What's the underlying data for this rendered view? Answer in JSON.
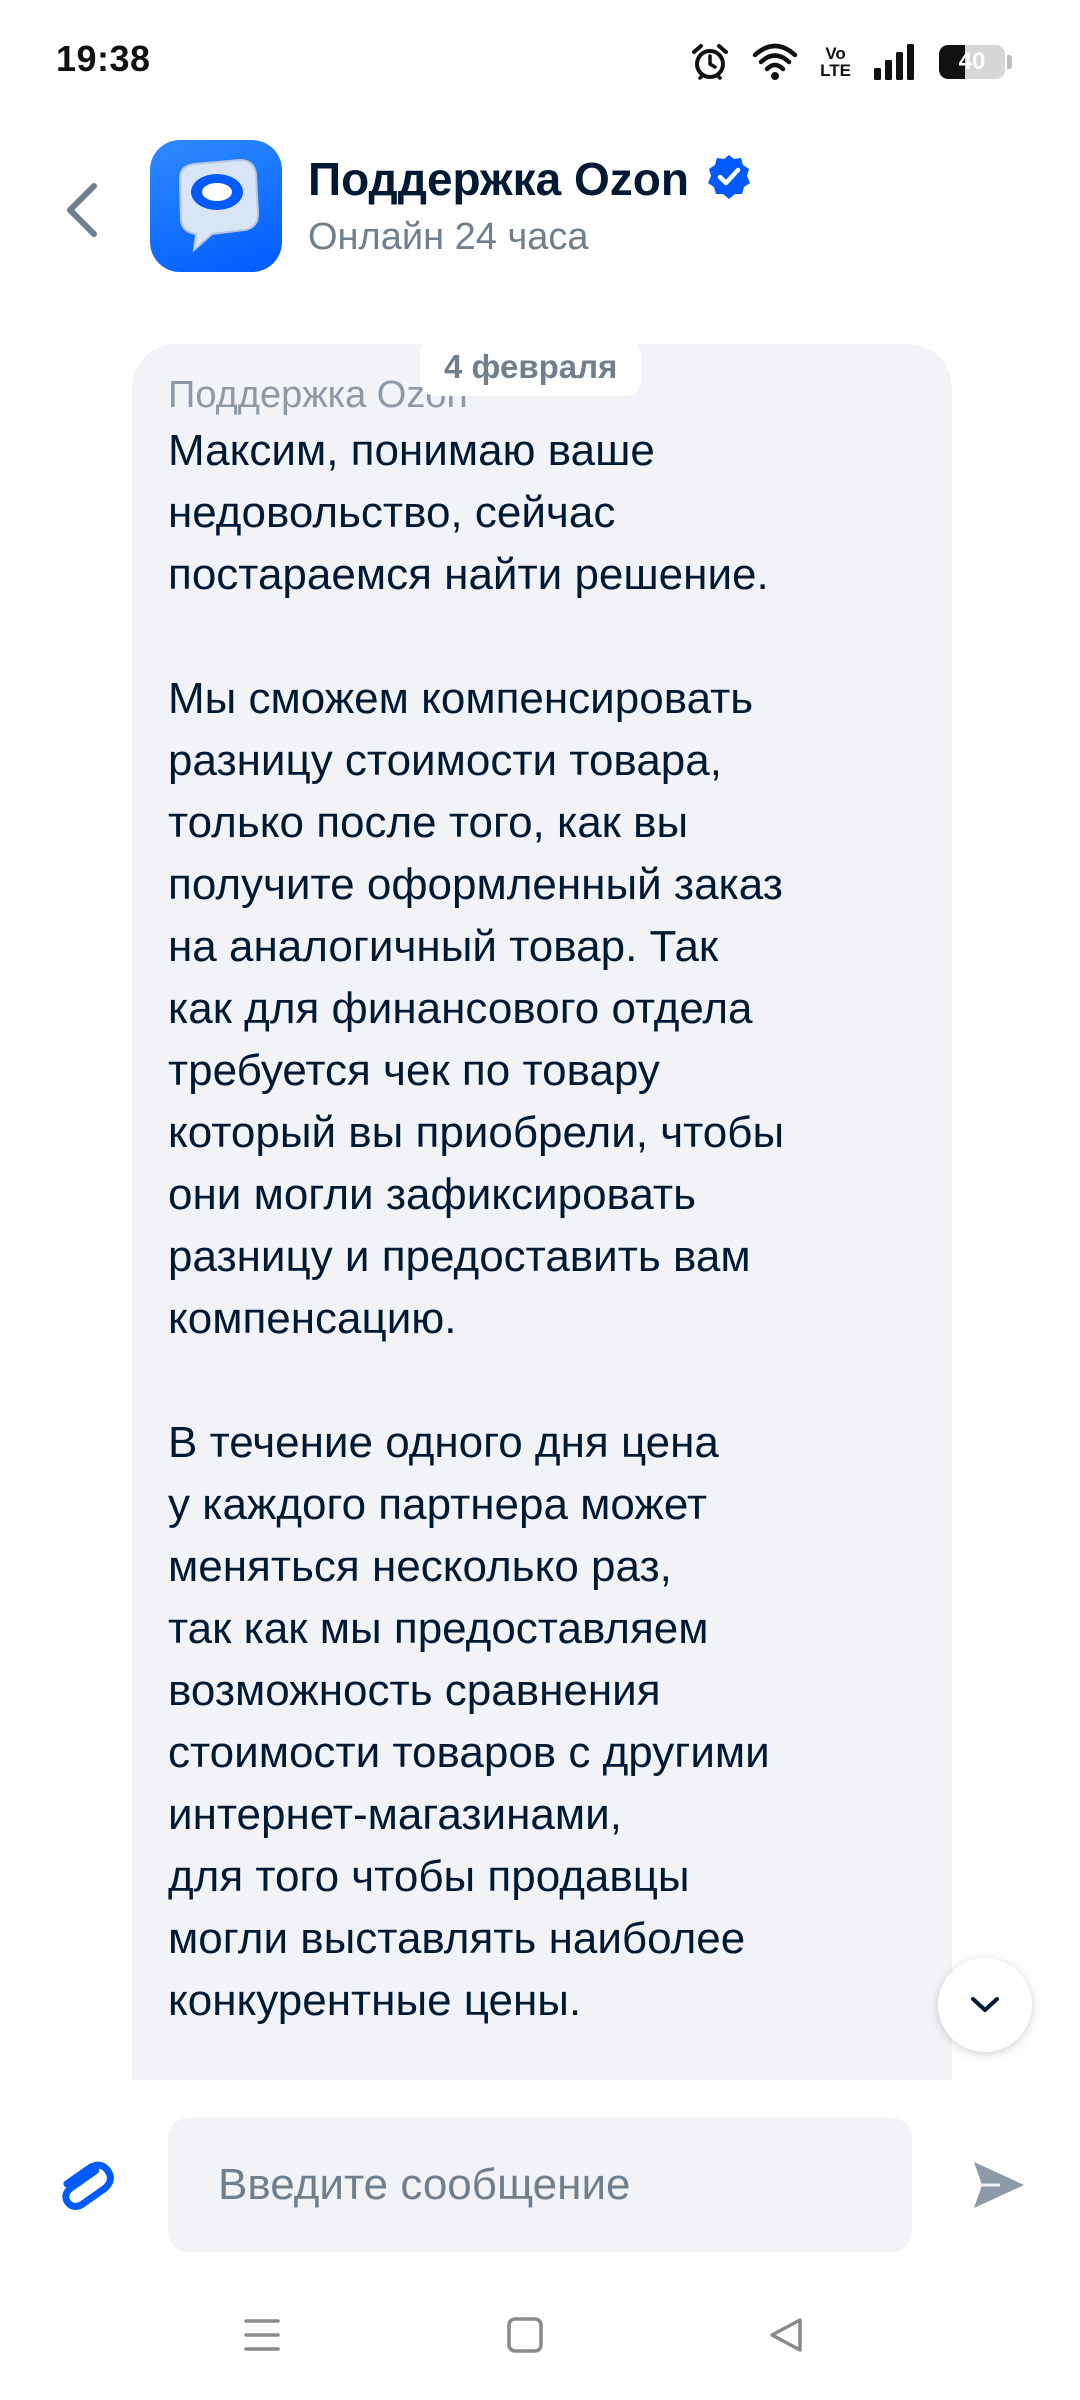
{
  "status_bar": {
    "time": "19:38",
    "network_label": "Vo\nLTE",
    "network_top": "Vo",
    "network_bottom": "LTE",
    "battery_level": "40",
    "icons": [
      "alarm-icon",
      "wifi-icon",
      "volte-icon",
      "signal-icon",
      "battery-icon"
    ]
  },
  "header": {
    "title": "Поддержка Ozon",
    "subtitle": "Онлайн 24 часа",
    "verified": true,
    "accent_color": "#005bff"
  },
  "chat": {
    "date_label": "4 февраля",
    "message": {
      "sender": "Поддержка Ozon",
      "paragraphs": [
        [
          "Максим, понимаю ваше",
          "недовольство, сейчас",
          "постараемся найти решение."
        ],
        [
          "Мы сможем компенсировать",
          "разницу стоимости товара,",
          "только после того, как вы",
          "получите оформленный заказ",
          "на аналогичный товар. Так",
          "как для финансового отдела",
          "требуется чек по товару",
          "который вы приобрели, чтобы",
          "они могли зафиксировать",
          "разницу и предоставить вам",
          "компенсацию."
        ],
        [
          "В течение одного дня цена",
          "у каждого партнера может",
          "меняться несколько раз,",
          "так как мы предоставляем",
          "возможность сравнения",
          "стоимости товаров с другими",
          "интернет-магазинами,",
          "для того чтобы продавцы",
          "могли выставлять наиболее",
          "конкурентные цены."
        ]
      ]
    }
  },
  "composer": {
    "placeholder": "Введите сообщение",
    "value": ""
  },
  "colors": {
    "brand_blue": "#005bff",
    "bubble_bg": "#f2f3f7",
    "text_primary": "#001a34",
    "text_secondary": "#707f8d"
  }
}
